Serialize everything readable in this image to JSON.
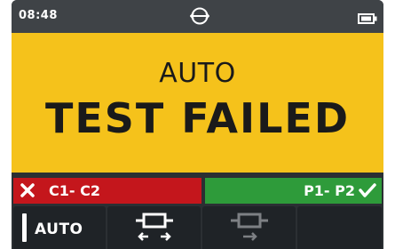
{
  "status_bar": {
    "time": "08:48",
    "connection_icon": "link-icon",
    "battery_icon": "battery-icon"
  },
  "main": {
    "mode": "AUTO",
    "result": "TEST FAILED",
    "background_color": "#f5c21b"
  },
  "pairs": {
    "fail": {
      "label": "C1- C2",
      "icon": "x-icon",
      "color": "#c4161c"
    },
    "pass": {
      "label": "P1- P2",
      "icon": "check-icon",
      "color": "#2e9b3a"
    }
  },
  "softkeys": [
    {
      "label": "AUTO",
      "icon": "mode-bar-icon"
    },
    {
      "label": "",
      "icon": "wiremap-bidirectional-icon"
    },
    {
      "label": "",
      "icon": "wiremap-single-icon"
    },
    {
      "label": "",
      "icon": ""
    }
  ]
}
